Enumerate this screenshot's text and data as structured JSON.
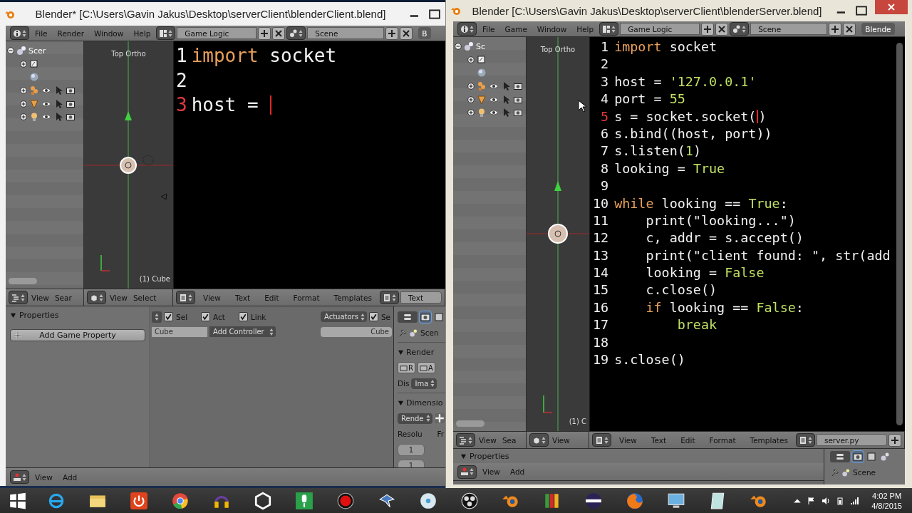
{
  "client_window": {
    "title": "Blender* [C:\\Users\\Gavin Jakus\\Desktop\\serverClient\\blenderClient.blend]",
    "menu": [
      "File",
      "Render",
      "Window",
      "Help"
    ],
    "layout": "Game Logic",
    "scene": "Scene",
    "engine": "B",
    "outliner_root": "Scer",
    "viewport": {
      "view": "Top Ortho",
      "object": "(1) Cube"
    },
    "code": [
      {
        "number": "1",
        "current": false,
        "tokens": [
          {
            "kind": "keyword",
            "text": "import"
          },
          {
            "kind": "plain",
            "text": " socket"
          }
        ]
      },
      {
        "number": "2",
        "current": false
      },
      {
        "number": "3",
        "current": true,
        "tokens": [
          {
            "kind": "plain",
            "text": "host = "
          },
          {
            "kind": "caret"
          }
        ]
      }
    ],
    "outliner_menu": [
      "View",
      "Sear"
    ],
    "viewport_menu": [
      "View",
      "Select"
    ],
    "text_menu": [
      "View",
      "Text",
      "Edit",
      "Format",
      "Templates"
    ],
    "text_name": "Text",
    "logic": {
      "properties_title": "Properties",
      "add_property": "Add Game Property",
      "controller_filters": [
        {
          "label": "Sel",
          "checked": true
        },
        {
          "label": "Act",
          "checked": true
        },
        {
          "label": "Link",
          "checked": true
        }
      ],
      "controller_object": "Cube",
      "add_controller": "Add Controller",
      "actuators_menu": "Actuators",
      "actuator_filters": [
        {
          "label": "Se",
          "checked": true
        }
      ],
      "actuator_object": "Cube"
    },
    "properties_editor": {
      "context": "Scen",
      "render_title": "Render",
      "render_buttons": [
        "R",
        "A"
      ],
      "display_label": "Dis",
      "display_value": "Ima",
      "dimensions_title": "Dimensio",
      "preset": "Rende",
      "resolution_label": "Resolu",
      "frame_label": "Fr",
      "resolution_values": [
        "1",
        "1"
      ]
    },
    "bottom_menu": [
      "View",
      "Add"
    ]
  },
  "server_window": {
    "title": "Blender [C:\\Users\\Gavin Jakus\\Desktop\\serverClient\\blenderServer.blend]",
    "menu": [
      "File",
      "Game",
      "Window",
      "Help"
    ],
    "layout": "Game Logic",
    "scene": "Scene",
    "engine": "Blende",
    "outliner_root": "Sc",
    "viewport": {
      "view": "Top Ortho",
      "object": "(1) C"
    },
    "code": [
      {
        "number": "1",
        "current": false,
        "tokens": [
          {
            "kind": "keyword",
            "text": "import"
          },
          {
            "kind": "plain",
            "text": " socket"
          }
        ]
      },
      {
        "number": "2",
        "current": false
      },
      {
        "number": "3",
        "current": false,
        "tokens": [
          {
            "kind": "plain",
            "text": "host = "
          },
          {
            "kind": "literal",
            "text": "'127.0.0.1'"
          }
        ]
      },
      {
        "number": "4",
        "current": false,
        "tokens": [
          {
            "kind": "plain",
            "text": "port = "
          },
          {
            "kind": "literal",
            "text": "55"
          }
        ]
      },
      {
        "number": "5",
        "current": true,
        "tokens": [
          {
            "kind": "plain",
            "text": "s = socket.socket("
          },
          {
            "kind": "caret"
          },
          {
            "kind": "plain",
            "text": ")"
          }
        ]
      },
      {
        "number": "6",
        "current": false,
        "tokens": [
          {
            "kind": "plain",
            "text": "s.bind((host, port))"
          }
        ]
      },
      {
        "number": "7",
        "current": false,
        "tokens": [
          {
            "kind": "plain",
            "text": "s.listen("
          },
          {
            "kind": "literal",
            "text": "1"
          },
          {
            "kind": "plain",
            "text": ")"
          }
        ]
      },
      {
        "number": "8",
        "current": false,
        "tokens": [
          {
            "kind": "plain",
            "text": "looking = "
          },
          {
            "kind": "literal",
            "text": "True"
          }
        ]
      },
      {
        "number": "9",
        "current": false
      },
      {
        "number": "10",
        "current": false,
        "tokens": [
          {
            "kind": "keyword",
            "text": "while"
          },
          {
            "kind": "plain",
            "text": " looking == "
          },
          {
            "kind": "literal",
            "text": "True"
          },
          {
            "kind": "plain",
            "text": ":"
          }
        ],
        "children": [
          {
            "number": "11",
            "current": false,
            "tokens": [
              {
                "kind": "plain",
                "text": "print(\"looking...\")"
              }
            ]
          },
          {
            "number": "12",
            "current": false,
            "tokens": [
              {
                "kind": "plain",
                "text": "c, addr = s.accept()"
              }
            ]
          },
          {
            "number": "13",
            "current": false,
            "tokens": [
              {
                "kind": "plain",
                "text": "print(\"client found: \", str(add"
              }
            ]
          },
          {
            "number": "14",
            "current": false,
            "tokens": [
              {
                "kind": "plain",
                "text": "looking = "
              },
              {
                "kind": "literal",
                "text": "False"
              }
            ]
          },
          {
            "number": "15",
            "current": false,
            "tokens": [
              {
                "kind": "plain",
                "text": "c.close()"
              }
            ]
          },
          {
            "number": "16",
            "current": false,
            "tokens": [
              {
                "kind": "keyword",
                "text": "if"
              },
              {
                "kind": "plain",
                "text": " looking == "
              },
              {
                "kind": "literal",
                "text": "False"
              },
              {
                "kind": "plain",
                "text": ":"
              }
            ],
            "children": [
              {
                "number": "17",
                "current": false,
                "tokens": [
                  {
                    "kind": "literal",
                    "text": "break"
                  }
                ]
              }
            ]
          }
        ]
      },
      {
        "number": "18",
        "current": false
      },
      {
        "number": "19",
        "current": false,
        "tokens": [
          {
            "kind": "plain",
            "text": "s.close()"
          }
        ]
      }
    ],
    "outliner_menu": [
      "View",
      "Sea"
    ],
    "viewport_menu": [
      "View"
    ],
    "text_menu": [
      "View",
      "Text",
      "Edit",
      "Format",
      "Templates"
    ],
    "text_name": "server.py",
    "logic": {
      "properties_title": "Properties"
    },
    "properties_editor": {
      "context": "Scene"
    },
    "bottom_menu": [
      "View",
      "Add"
    ]
  },
  "taskbar": {
    "time": "4:02 PM",
    "date": "4/8/2015"
  }
}
